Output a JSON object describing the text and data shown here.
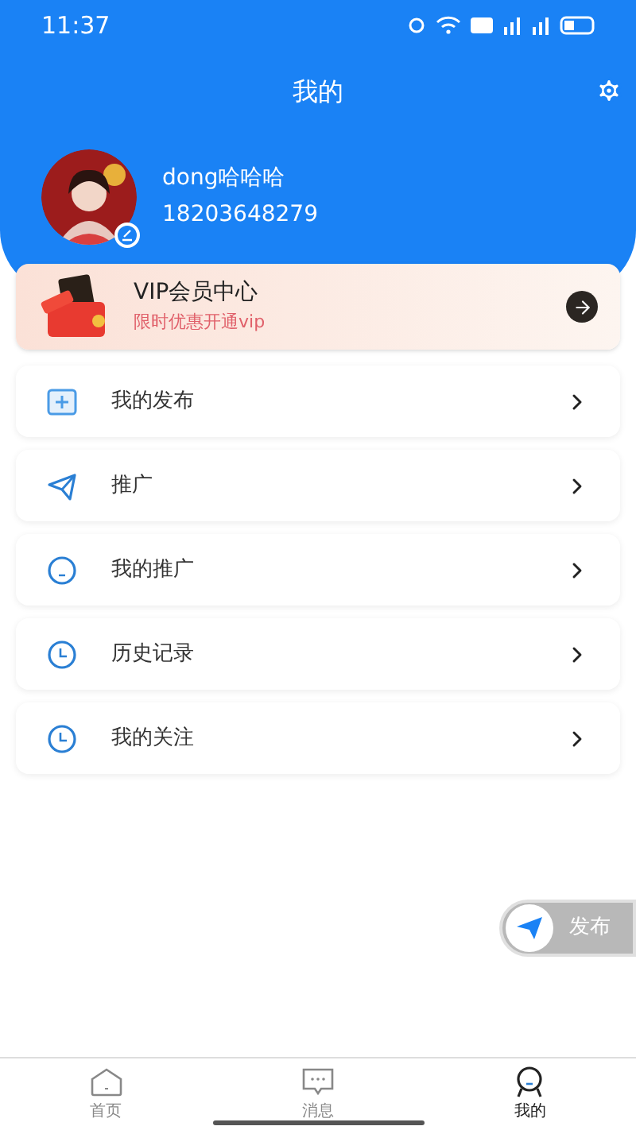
{
  "status_bar": {
    "time": "11:37"
  },
  "header": {
    "title": "我的"
  },
  "profile": {
    "name": "dong哈哈哈",
    "phone": "18203648279"
  },
  "vip": {
    "title": "VIP会员中心",
    "subtitle": "限时优惠开通vip"
  },
  "menu": [
    {
      "label": "我的发布",
      "kind": "add"
    },
    {
      "label": "推广",
      "kind": "send"
    },
    {
      "label": "我的推广",
      "kind": "face"
    },
    {
      "label": "历史记录",
      "kind": "clock"
    },
    {
      "label": "我的关注",
      "kind": "clock"
    }
  ],
  "fab": {
    "label": "发布"
  },
  "tabs": [
    {
      "label": "首页",
      "kind": "home",
      "selected": false
    },
    {
      "label": "消息",
      "kind": "chat",
      "selected": false
    },
    {
      "label": "我的",
      "kind": "me",
      "selected": true
    }
  ]
}
